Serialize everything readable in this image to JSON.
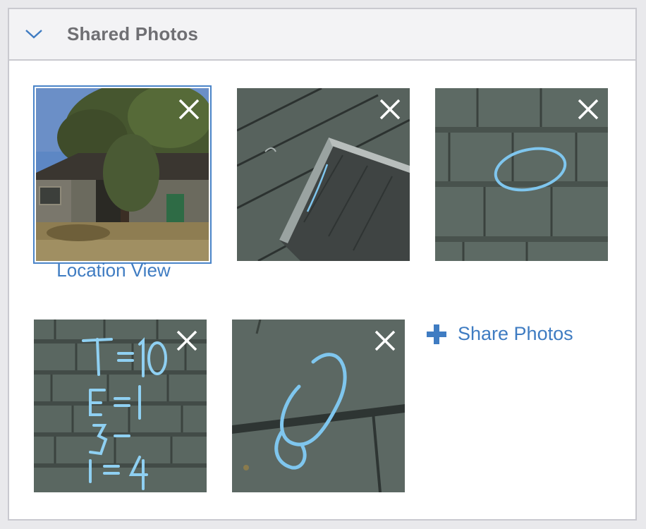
{
  "panel": {
    "title": "Shared Photos",
    "expanded": true,
    "toggle_icon": "chevron-down-icon"
  },
  "photos": [
    {
      "id": "photo-1",
      "subject": "house-exterior",
      "caption": "Location View",
      "selected": true,
      "remove_icon": "close-icon"
    },
    {
      "id": "photo-2",
      "subject": "roof-vent",
      "caption": "",
      "selected": false,
      "remove_icon": "close-icon"
    },
    {
      "id": "photo-3",
      "subject": "roof-shingles-chalk-circle",
      "caption": "",
      "selected": false,
      "remove_icon": "close-icon"
    },
    {
      "id": "photo-4",
      "subject": "roof-shingles-chalk-notes",
      "caption": "",
      "selected": false,
      "remove_icon": "close-icon"
    },
    {
      "id": "photo-5",
      "subject": "roof-shingles-chalk-mark",
      "caption": "",
      "selected": false,
      "remove_icon": "close-icon"
    }
  ],
  "share": {
    "label": "Share Photos",
    "icon": "plus-icon"
  },
  "colors": {
    "accent": "#3f7cc2",
    "header_bg": "#f3f3f5",
    "border": "#c9c9cf",
    "chalk": "#7fc6ee"
  }
}
